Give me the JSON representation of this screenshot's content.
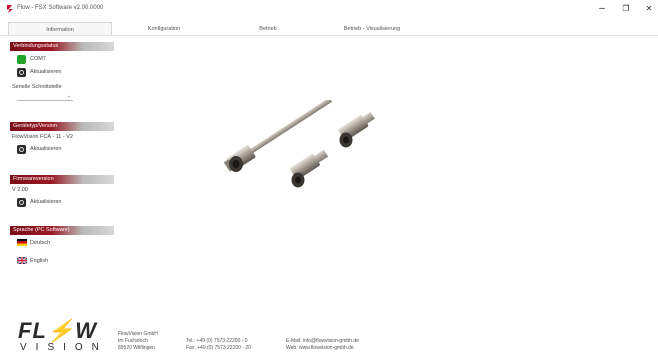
{
  "window": {
    "title": "Flow - FSX Software v2.00.0000",
    "minimize_glyph": "–",
    "maximize_glyph": "❐",
    "close_glyph": "✕"
  },
  "tabs": [
    {
      "label": "Information"
    },
    {
      "label": "Konfiguration"
    },
    {
      "label": "Betrieb"
    },
    {
      "label": "Betrieb - Visualisierung"
    }
  ],
  "sidebar": {
    "connection": {
      "header": "Verbindungsstatus",
      "status_label": "COM7",
      "refresh_label": "Aktualisieren",
      "port_label": "Serielle Schnittstelle",
      "port_value": ""
    },
    "device": {
      "header": "Gerätetyp/Version",
      "device_name": "FlowVision FCA - 11 - V2",
      "refresh_label": "Aktualisieren"
    },
    "firmware": {
      "header": "Firmwareversion",
      "version": "V 2.00",
      "refresh_label": "Aktualisieren"
    },
    "language": {
      "header": "Sprache (PC Software)",
      "german_label": "Deutsch",
      "english_label": "English"
    }
  },
  "footer": {
    "logo_top": "FL⚡W",
    "logo_bottom": "VISION",
    "company": [
      "FlowVision GmbH",
      "Im Fuchsloch",
      "89520 Wilflingen"
    ],
    "phone": [
      "Tel.: +49 (0) 7573 22200 - 0",
      "Fax: +49 (0) 7573 22200 - 20"
    ],
    "web": [
      "E-Mail: info@flowvision-gmbh.de",
      "Web: www.flowvision-gmbh.de"
    ]
  },
  "colors": {
    "header_red": "#8a141e",
    "status_green": "#22a52b",
    "logo_red": "#c8102e"
  }
}
